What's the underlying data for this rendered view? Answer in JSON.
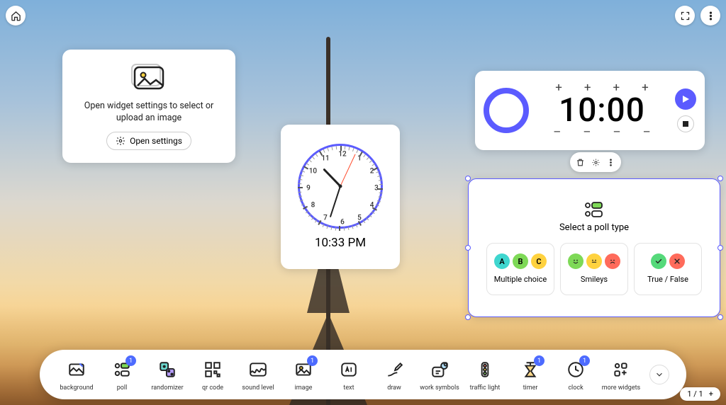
{
  "top": {
    "home": "home-icon",
    "fullscreen": "fullscreen-icon",
    "more": "more-icon"
  },
  "image_widget": {
    "message": "Open widget settings to select or upload an image",
    "button_label": "Open settings"
  },
  "clock_widget": {
    "time_label": "10:33 PM",
    "hour_angle": 316,
    "minute_angle": 198,
    "second_angle": 25,
    "numbers": [
      "12",
      "1",
      "2",
      "3",
      "4",
      "5",
      "6",
      "7",
      "8",
      "9",
      "10",
      "11"
    ]
  },
  "timer_widget": {
    "value": "10:00",
    "plus": "+",
    "minus": "–"
  },
  "poll_widget": {
    "title": "Select a poll type",
    "options": [
      {
        "label": "Multiple choice",
        "letters": [
          "A",
          "B",
          "C"
        ],
        "colors": [
          "#3fd6cf",
          "#7ed957",
          "#ffd23f"
        ]
      },
      {
        "label": "Smileys",
        "faces": [
          "happy",
          "neutral",
          "sad"
        ],
        "colors": [
          "#7ed957",
          "#ffd23f",
          "#ff6b5b"
        ]
      },
      {
        "label": "True / False",
        "marks": [
          "check",
          "cross"
        ],
        "colors": [
          "#55d97a",
          "#ff6b5b"
        ]
      }
    ]
  },
  "toolbar": {
    "items": [
      {
        "id": "background",
        "label": "background",
        "badge": null
      },
      {
        "id": "poll",
        "label": "poll",
        "badge": "1"
      },
      {
        "id": "randomizer",
        "label": "randomizer",
        "badge": null
      },
      {
        "id": "qrcode",
        "label": "qr code",
        "badge": null
      },
      {
        "id": "sound",
        "label": "sound level",
        "badge": null
      },
      {
        "id": "image",
        "label": "image",
        "badge": "1"
      },
      {
        "id": "text",
        "label": "text",
        "badge": null
      },
      {
        "id": "draw",
        "label": "draw",
        "badge": null
      },
      {
        "id": "work",
        "label": "work symbols",
        "badge": null
      },
      {
        "id": "traffic",
        "label": "traffic light",
        "badge": null
      },
      {
        "id": "timer",
        "label": "timer",
        "badge": "1"
      },
      {
        "id": "clock",
        "label": "clock",
        "badge": "1"
      },
      {
        "id": "morew",
        "label": "more widgets",
        "badge": null
      }
    ]
  },
  "pager": {
    "label": "1 / 1",
    "plus": "+"
  }
}
